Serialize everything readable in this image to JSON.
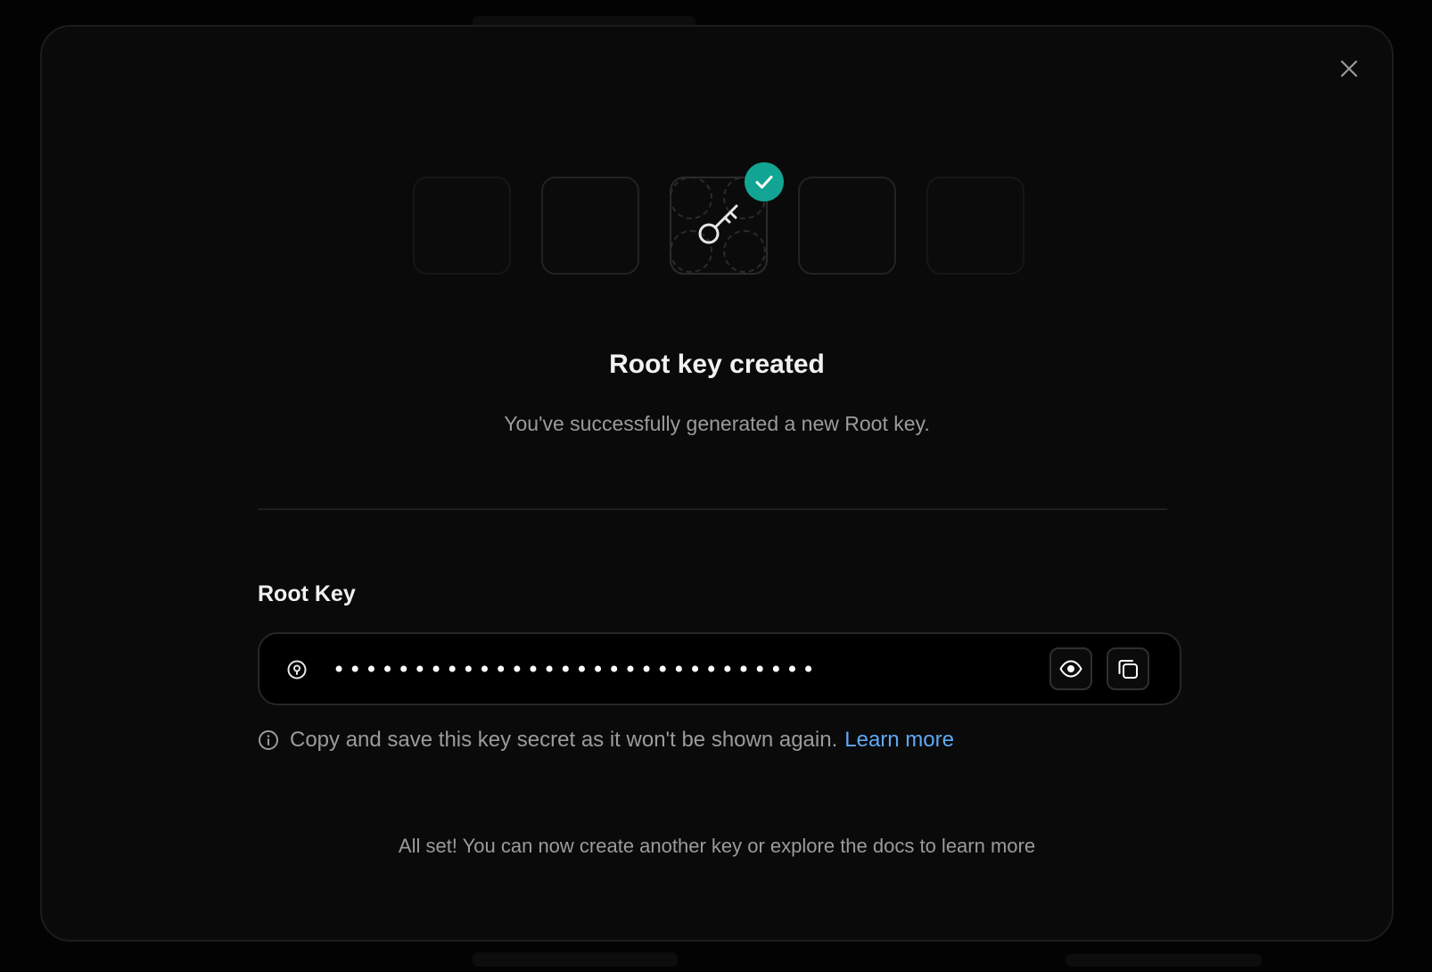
{
  "dialog": {
    "title": "Root key created",
    "subtitle": "You've successfully generated a new Root key.",
    "close_icon": "close-icon"
  },
  "illustration": {
    "center_icon": "key-icon",
    "badge_icon": "check-icon",
    "badge_color": "#12a594"
  },
  "root_key": {
    "label": "Root Key",
    "masked_value": "••••••••••••••••••••••••••••••",
    "leading_icon": "key-pin-icon",
    "reveal_icon": "eye-icon",
    "copy_icon": "copy-icon"
  },
  "hint": {
    "text": "Copy and save this key secret as it won't be shown again.",
    "link_text": "Learn more",
    "link_color": "#5ea8f7",
    "icon": "info-icon"
  },
  "footer": {
    "text": "All set! You can now create another key or explore the docs to learn more"
  }
}
